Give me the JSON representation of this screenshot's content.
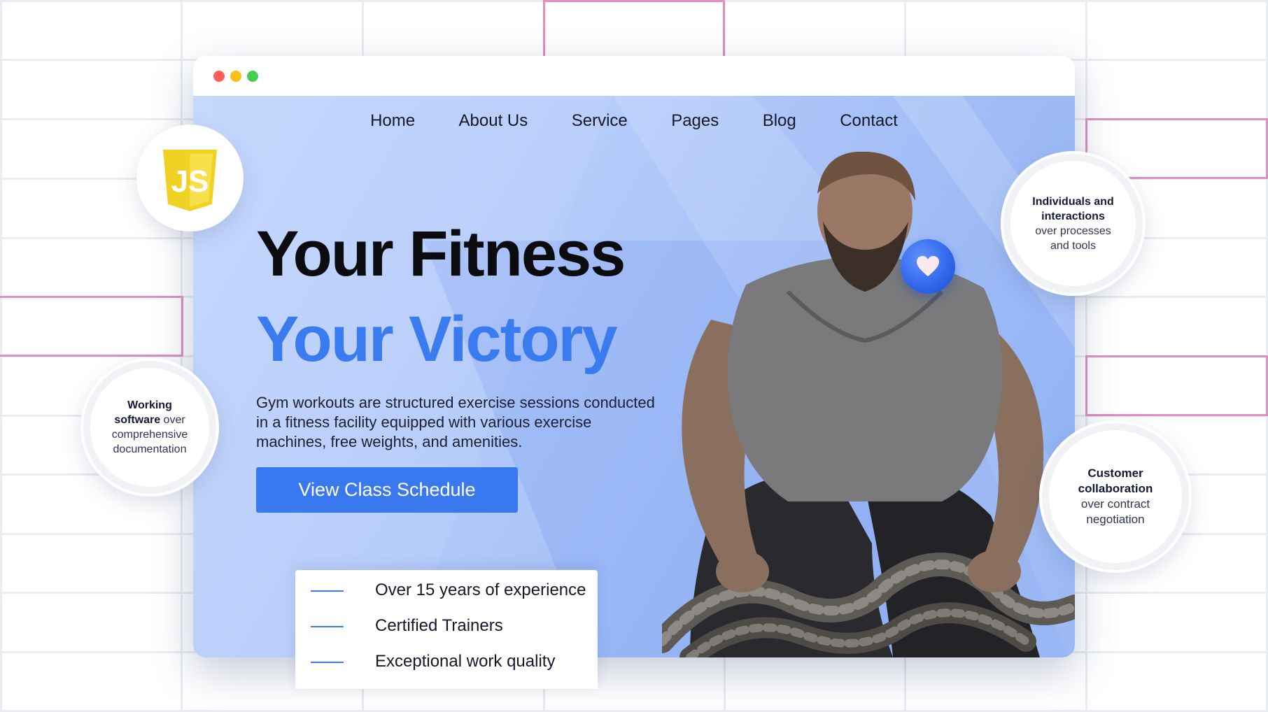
{
  "window": {
    "controls": [
      "close",
      "minimize",
      "maximize"
    ]
  },
  "nav": {
    "items": [
      "Home",
      "About Us",
      "Service",
      "Pages",
      "Blog",
      "Contact"
    ]
  },
  "hero": {
    "title_line1": "Your Fitness",
    "title_line2": "Your Victory",
    "description": "Gym workouts are structured exercise sessions conducted in a fitness facility equipped with various exercise machines, free weights, and amenities.",
    "cta_label": "View Class Schedule"
  },
  "features": {
    "items": [
      "Over 15 years of experience",
      "Certified Trainers",
      "Exceptional work quality"
    ]
  },
  "badges": {
    "js_logo_text": "JS",
    "working": {
      "bold1": "Working",
      "bold2": "software",
      "rest1": " over",
      "rest2": "comprehensive",
      "rest3": "documentation"
    },
    "individuals": {
      "bold1": "Individuals and",
      "bold2": "interactions",
      "rest1": "over processes",
      "rest2": "and tools"
    },
    "customer": {
      "bold1": "Customer",
      "bold2": "collaboration",
      "rest1": "over contract",
      "rest2": "negotiation"
    }
  },
  "colors": {
    "accent": "#3a7bf0",
    "button": "#3a78ef",
    "title_dark": "#0b0b10",
    "pink_outline": "#e08fbe",
    "js_yellow": "#f0d225"
  },
  "icons": [
    "heart-icon",
    "javascript-logo-icon"
  ]
}
